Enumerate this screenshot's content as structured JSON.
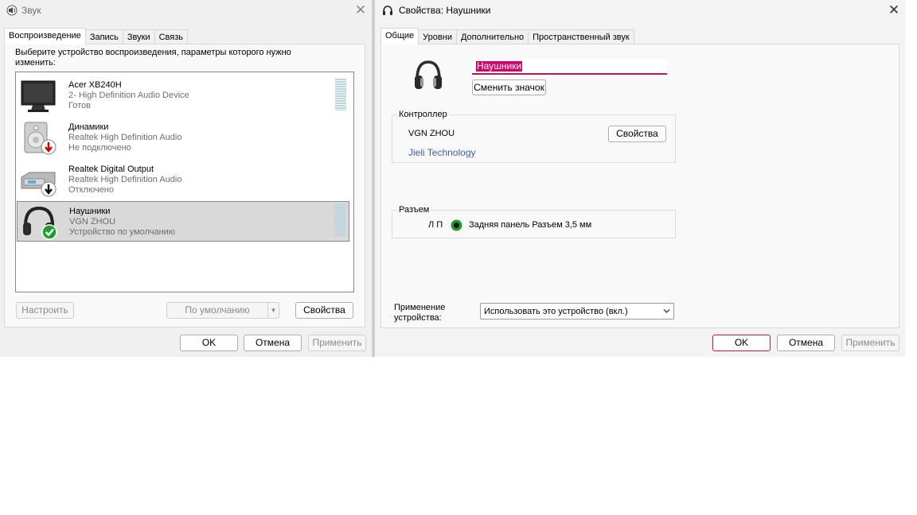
{
  "sound_window": {
    "title": "Звук",
    "close_glyph": "✕",
    "tabs": [
      "Воспроизведение",
      "Запись",
      "Звуки",
      "Связь"
    ],
    "instruction": "Выберите устройство воспроизведения, параметры которого нужно изменить:",
    "devices": [
      {
        "name": "Acer XB240H",
        "line2": "2- High Definition Audio Device",
        "line3": "Готов",
        "icon": "monitor-icon",
        "selected": false
      },
      {
        "name": "Динамики",
        "line2": "Realtek High Definition Audio",
        "line3": "Не подключено",
        "icon": "speaker-icon",
        "badge": "red-down-arrow",
        "selected": false
      },
      {
        "name": "Realtek Digital Output",
        "line2": "Realtek High Definition Audio",
        "line3": "Отключено",
        "icon": "digital-output-icon",
        "badge": "black-down-arrow",
        "selected": false
      },
      {
        "name": "Наушники",
        "line2": "VGN ZHOU",
        "line3": "Устройство по умолчанию",
        "icon": "headphones-icon",
        "badge": "green-check",
        "selected": true
      }
    ],
    "buttons": {
      "configure": "Настроить",
      "set_default": "По умолчанию",
      "properties": "Свойства",
      "ok": "OK",
      "cancel": "Отмена",
      "apply": "Применить"
    }
  },
  "props_window": {
    "title": "Свойства: Наушники",
    "close_glyph": "✕",
    "tabs": [
      "Общие",
      "Уровни",
      "Дополнительно",
      "Пространственный звук"
    ],
    "device_name_value": "Наушники",
    "change_icon_label": "Сменить значок",
    "controller": {
      "label": "Контроллер",
      "device": "VGN ZHOU",
      "vendor": "Jieli Technology",
      "properties_label": "Свойства"
    },
    "jack": {
      "label": "Разъем",
      "channels": "Л П",
      "description": "Задняя панель Разъем 3,5 мм"
    },
    "usage": {
      "label": "Применение устройства:",
      "selected": "Использовать это устройство (вкл.)"
    },
    "buttons": {
      "ok": "OK",
      "cancel": "Отмена",
      "apply": "Применить"
    }
  },
  "colors": {
    "accent": "#c1144f",
    "selection_highlight": "#d6006b",
    "link": "#3c5ea8",
    "jack_green": "#1e9e2e"
  }
}
